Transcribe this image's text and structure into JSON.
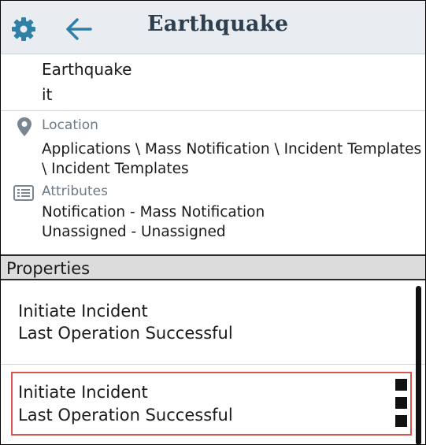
{
  "header": {
    "title": "Earthquake",
    "settings_icon": "gear-icon",
    "back_icon": "arrow-left-icon",
    "accent_color": "#2f7fa6"
  },
  "object": {
    "name": "Earthquake",
    "subtitle": "it"
  },
  "location": {
    "icon": "map-pin-icon",
    "label": "Location",
    "value": "Applications \\ Mass Notification \\ Incident Templates \\ Incident Templates"
  },
  "attributes": {
    "icon": "list-icon",
    "label": "Attributes",
    "lines": [
      "Notification - Mass Notification",
      "Unassigned - Unassigned"
    ]
  },
  "properties": {
    "label": "Properties",
    "items": [
      {
        "title": "Initiate Incident",
        "status": "Last Operation Successful"
      },
      {
        "title": "Initiate Incident",
        "status": "Last Operation Successful"
      }
    ]
  },
  "colors": {
    "header_bg": "#e9edf1",
    "highlight_border": "#d9534f",
    "muted_label": "#6b7a87"
  }
}
